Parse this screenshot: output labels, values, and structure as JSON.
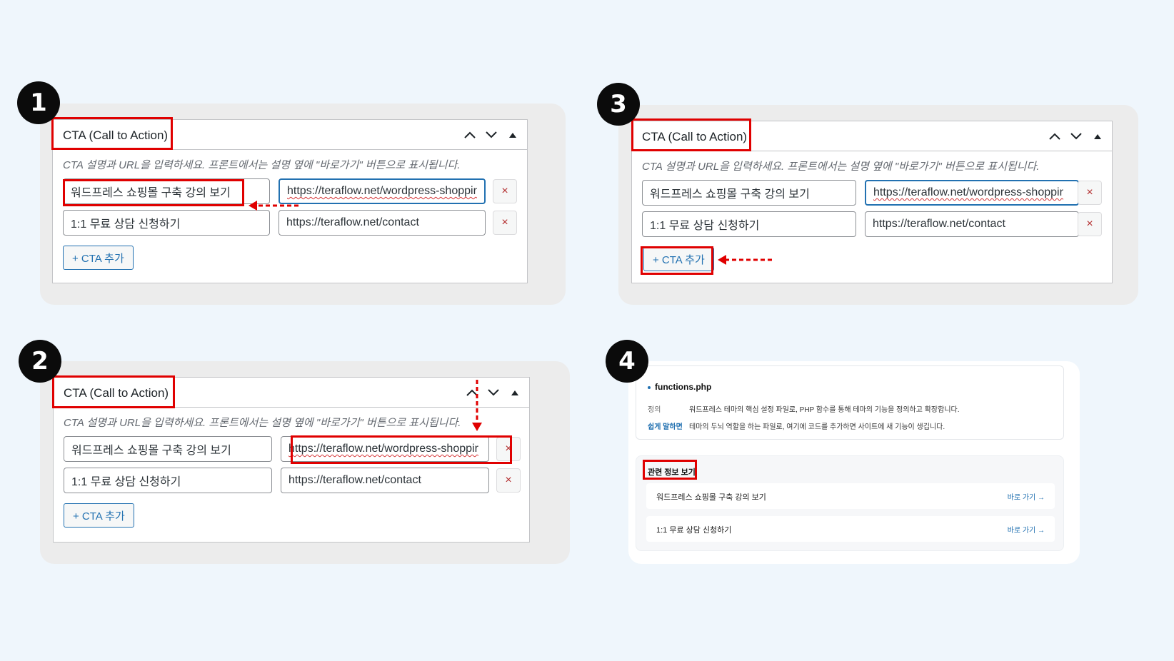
{
  "steps": [
    "1",
    "2",
    "3",
    "4"
  ],
  "metabox": {
    "title": "CTA (Call to Action)",
    "description": "CTA 설명과 URL을 입력하세요. 프론트에서는 설명 옆에 \"바로가기\" 버튼으로 표시됩니다.",
    "rows": [
      {
        "label": "워드프레스 쇼핑몰 구축 강의 보기",
        "url": "https://teraflow.net/wordpress-shoppir"
      },
      {
        "label": "1:1 무료 상담 신청하기",
        "url": "https://teraflow.net/contact"
      }
    ],
    "delete_label": "×",
    "add_label": "+ CTA 추가",
    "ctrl_up": "chevron-up-icon",
    "ctrl_down": "chevron-down-icon",
    "ctrl_toggle": "triangle-up-icon"
  },
  "preview": {
    "term": "functions.php",
    "def_key": "정의",
    "def_text": "워드프레스 테마의 핵심 설정 파일로, PHP 함수를 통해 테마의 기능을 정의하고 확장합니다.",
    "easy_key": "쉽게 말하면",
    "easy_text": "테마의 두뇌 역할을 하는 파일로, 여기에 코드를 추가하면 사이트에 새 기능이 생깁니다.",
    "related_title": "관련 정보 보기",
    "items": [
      {
        "label": "워드프레스 쇼핑몰 구축 강의 보기",
        "go": "바로 가기 →"
      },
      {
        "label": "1:1 무료 상담 신청하기",
        "go": "바로 가기 →"
      }
    ]
  },
  "colors": {
    "highlight": "#e00000",
    "accent": "#2271b1",
    "delete": "#b32d2e"
  }
}
